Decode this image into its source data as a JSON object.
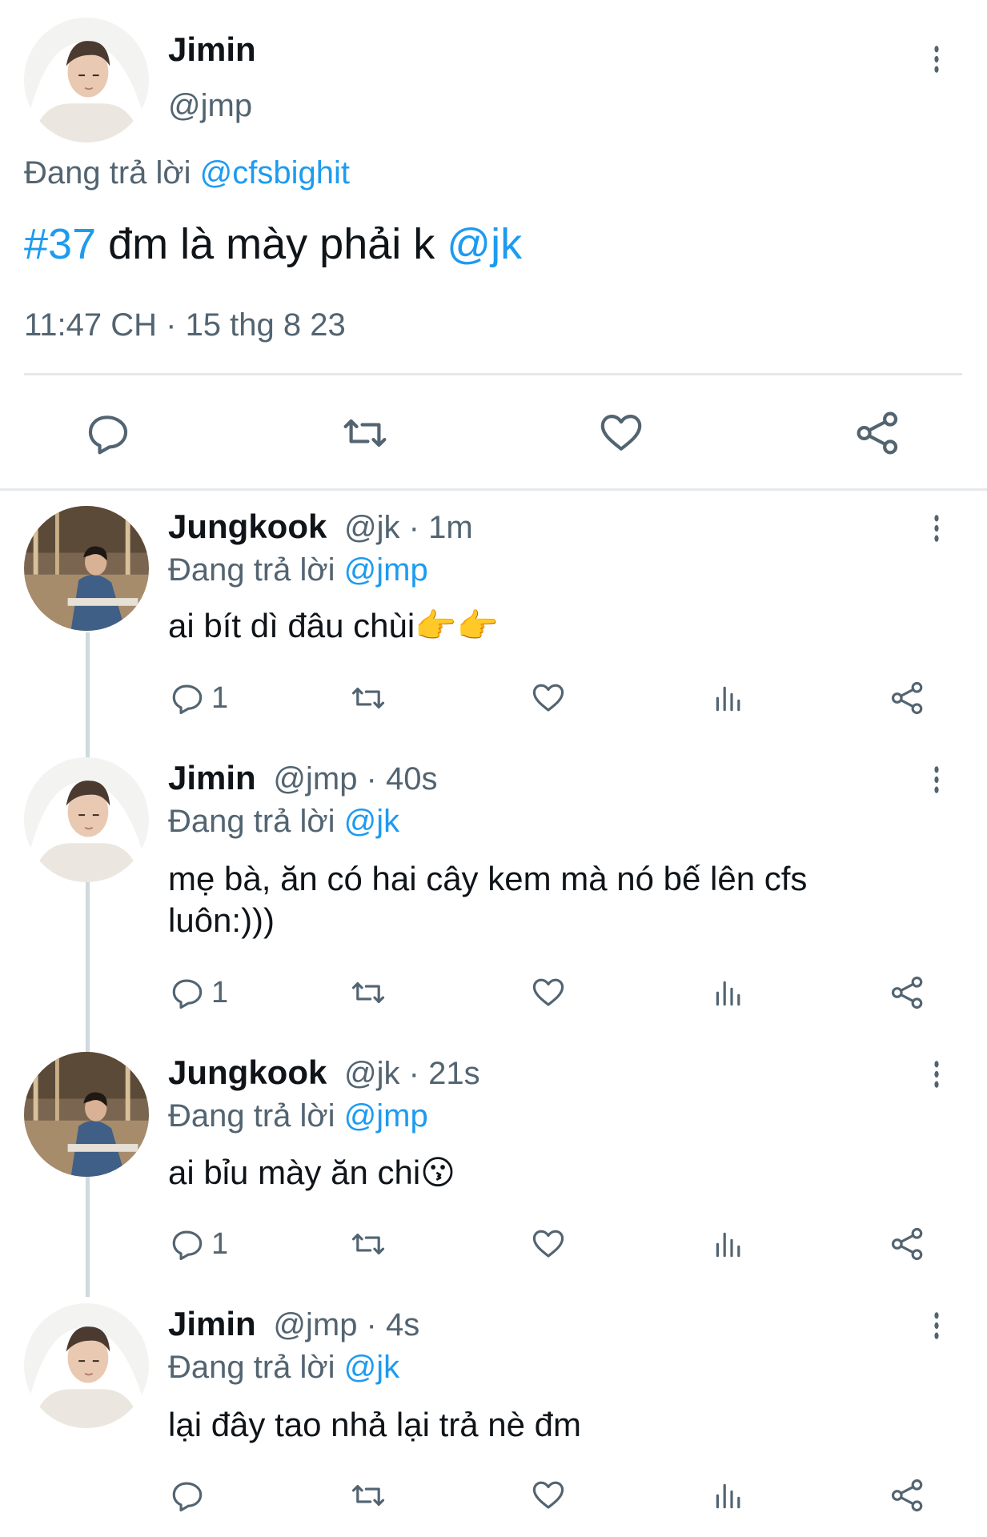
{
  "main_tweet": {
    "name": "Jimin",
    "handle": "@jmp",
    "reply_prefix": "Đang trả lời",
    "reply_to": "@cfsbighit",
    "text_hashtag": "#37",
    "text_body": " đm là mày phải k ",
    "text_mention": "@jk",
    "timestamp": "11:47 CH · 15 thg 8 23"
  },
  "replies": [
    {
      "name": "Jungkook",
      "meta": "@jk · 1m",
      "reply_prefix": "Đang trả lời",
      "reply_to": "@jmp",
      "text": "ai bít dì đâu chùi",
      "emoji": "👉👉",
      "reply_count": "1"
    },
    {
      "name": "Jimin",
      "meta": "@jmp · 40s",
      "reply_prefix": "Đang trả lời",
      "reply_to": "@jk",
      "text_line1": "mẹ bà, ăn có hai cây kem mà nó bế lên cfs",
      "text_line2": "luôn:)))",
      "reply_count": "1"
    },
    {
      "name": "Jungkook",
      "meta": "@jk · 21s",
      "reply_prefix": "Đang trả lời",
      "reply_to": "@jmp",
      "text": "ai bỉu mày ăn chi",
      "emoji": "😗",
      "reply_count": "1"
    },
    {
      "name": "Jimin",
      "meta": "@jmp · 4s",
      "reply_prefix": "Đang trả lời",
      "reply_to": "@jk",
      "text": "lại đây tao nhả lại trả nè đm"
    }
  ],
  "colors": {
    "accent": "#1d9bf0",
    "text": "#0f1419",
    "muted": "#536471",
    "divider": "#e6e9eb"
  },
  "icons": [
    "more-vertical-icon",
    "reply-icon",
    "retweet-icon",
    "like-icon",
    "share-icon",
    "views-icon"
  ]
}
